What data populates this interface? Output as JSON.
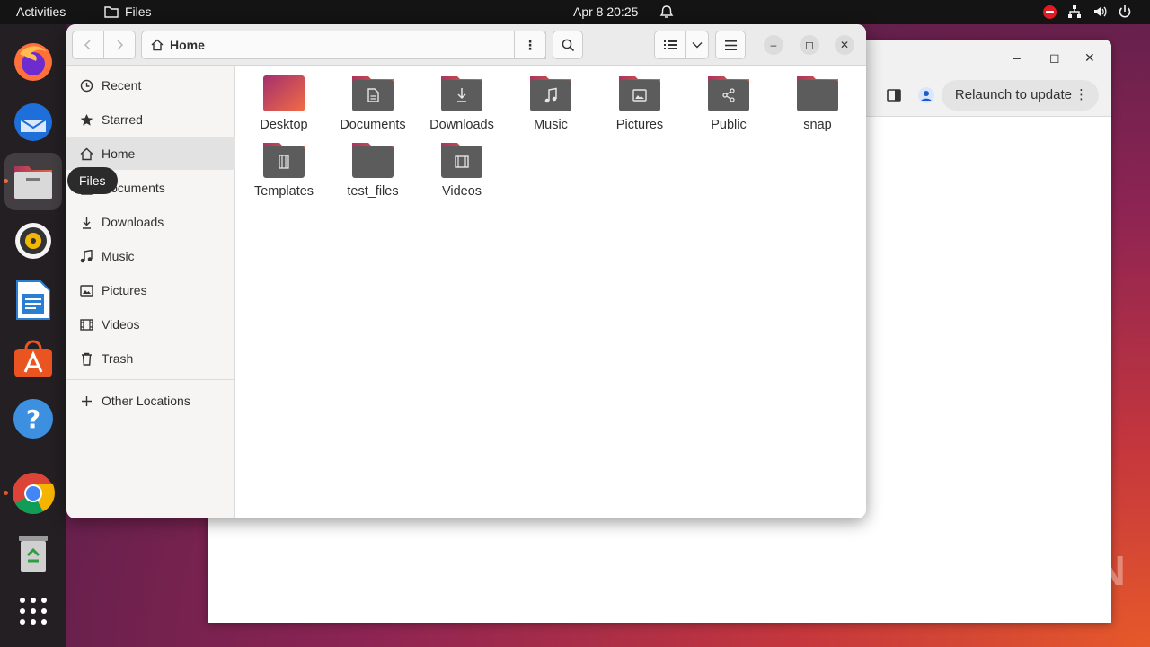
{
  "topbar": {
    "activities": "Activities",
    "app_name": "Files",
    "clock": "Apr 8  20:25"
  },
  "dock": {
    "tooltip": "Files",
    "items": [
      "firefox-icon",
      "thunderbird-icon",
      "files-icon",
      "rhythmbox-icon",
      "libreoffice-writer-icon",
      "ubuntu-software-icon",
      "help-icon",
      "chrome-icon",
      "trash-icon",
      "show-apps-icon"
    ]
  },
  "browser": {
    "relaunch_label": "Relaunch to update"
  },
  "files": {
    "path_label": "Home",
    "sidebar": {
      "items": [
        {
          "label": "Recent",
          "icon": "clock-icon"
        },
        {
          "label": "Starred",
          "icon": "star-icon"
        },
        {
          "label": "Home",
          "icon": "home-icon"
        },
        {
          "label": "Documents",
          "icon": "document-icon"
        },
        {
          "label": "Downloads",
          "icon": "download-icon"
        },
        {
          "label": "Music",
          "icon": "music-icon"
        },
        {
          "label": "Pictures",
          "icon": "picture-icon"
        },
        {
          "label": "Videos",
          "icon": "video-icon"
        },
        {
          "label": "Trash",
          "icon": "trash-icon"
        }
      ],
      "other_locations": "Other Locations"
    },
    "folders": [
      {
        "label": "Desktop",
        "icon": "desktop-folder-icon"
      },
      {
        "label": "Documents",
        "icon": "documents-folder-icon"
      },
      {
        "label": "Downloads",
        "icon": "downloads-folder-icon"
      },
      {
        "label": "Music",
        "icon": "music-folder-icon"
      },
      {
        "label": "Pictures",
        "icon": "pictures-folder-icon"
      },
      {
        "label": "Public",
        "icon": "public-folder-icon"
      },
      {
        "label": "snap",
        "icon": "folder-icon"
      },
      {
        "label": "Templates",
        "icon": "templates-folder-icon"
      },
      {
        "label": "test_files",
        "icon": "folder-icon"
      },
      {
        "label": "Videos",
        "icon": "videos-folder-icon"
      }
    ]
  },
  "watermark": "ANY RUN",
  "colors": {
    "accent": "#e95420",
    "folder_dark": "#5b5b5b",
    "folder_tab": "#c7475d"
  }
}
